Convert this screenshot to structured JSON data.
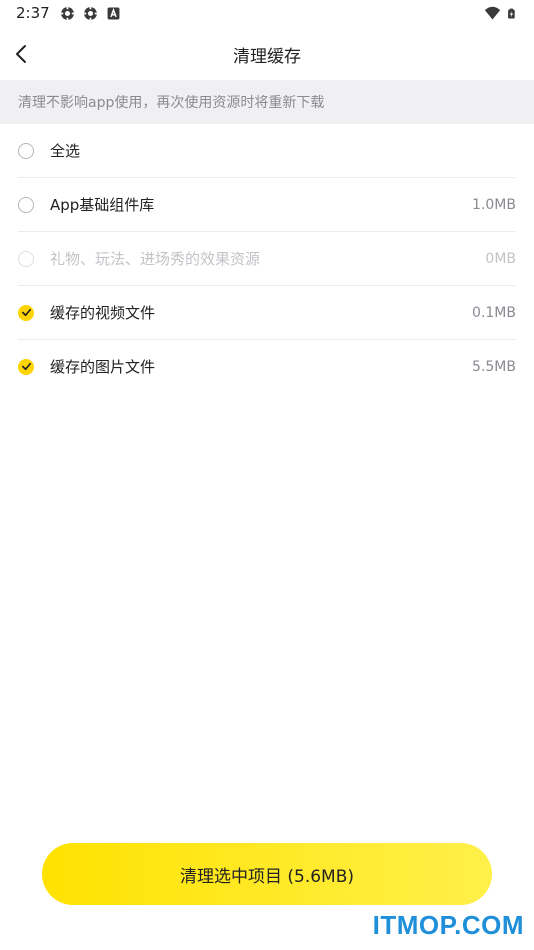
{
  "status_bar": {
    "time": "2:37",
    "left_icons": [
      "settings-cog-icon",
      "settings-cog-icon",
      "app-a-icon"
    ],
    "right_icons": [
      "wifi-icon",
      "battery-charging-icon"
    ]
  },
  "header": {
    "title": "清理缓存",
    "back_icon": "chevron-left-icon"
  },
  "notice": "清理不影响app使用，再次使用资源时将重新下载",
  "items": [
    {
      "label": "全选",
      "size": "",
      "checked": false,
      "disabled": false
    },
    {
      "label": "App基础组件库",
      "size": "1.0MB",
      "checked": false,
      "disabled": false
    },
    {
      "label": "礼物、玩法、进场秀的效果资源",
      "size": "0MB",
      "checked": false,
      "disabled": true
    },
    {
      "label": "缓存的视频文件",
      "size": "0.1MB",
      "checked": true,
      "disabled": false
    },
    {
      "label": "缓存的图片文件",
      "size": "5.5MB",
      "checked": true,
      "disabled": false
    }
  ],
  "clean_button": {
    "label": "清理选中项目 (5.6MB)"
  },
  "watermark": "ITMOP.COM",
  "colors": {
    "accent": "#ffd400",
    "notice_bg": "#f0f0f3",
    "watermark": "#1e8fd8"
  }
}
